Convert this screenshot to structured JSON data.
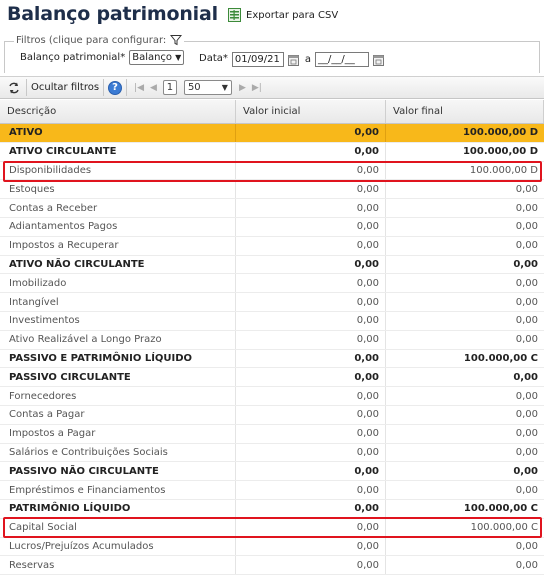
{
  "header": {
    "title": "Balanço patrimonial",
    "export_label": "Exportar para CSV"
  },
  "filters": {
    "legend": "Filtros (clique para configurar:",
    "report_label": "Balanço patrimonial*",
    "report_value": "Balanço",
    "date_label": "Data*",
    "date_from": "01/09/21",
    "date_sep": "a",
    "date_to": "__/__/__"
  },
  "toolbar": {
    "hide_filters_label": "Ocultar filtros",
    "help_glyph": "?",
    "page": "1",
    "page_size": "50"
  },
  "grid": {
    "columns": [
      "Descrição",
      "Valor inicial",
      "Valor final"
    ],
    "rows": [
      {
        "desc": "ATIVO",
        "ini": "0,00",
        "fin": "100.000,00 D",
        "style": "hl"
      },
      {
        "desc": "ATIVO CIRCULANTE",
        "ini": "0,00",
        "fin": "100.000,00 D",
        "style": "group"
      },
      {
        "desc": "Disponibilidades",
        "ini": "0,00",
        "fin": "100.000,00 D",
        "style": "normal"
      },
      {
        "desc": "Estoques",
        "ini": "0,00",
        "fin": "0,00",
        "style": "normal"
      },
      {
        "desc": "Contas a Receber",
        "ini": "0,00",
        "fin": "0,00",
        "style": "normal"
      },
      {
        "desc": "Adiantamentos Pagos",
        "ini": "0,00",
        "fin": "0,00",
        "style": "normal"
      },
      {
        "desc": "Impostos a Recuperar",
        "ini": "0,00",
        "fin": "0,00",
        "style": "normal"
      },
      {
        "desc": "ATIVO NÃO CIRCULANTE",
        "ini": "0,00",
        "fin": "0,00",
        "style": "group"
      },
      {
        "desc": "Imobilizado",
        "ini": "0,00",
        "fin": "0,00",
        "style": "normal"
      },
      {
        "desc": "Intangível",
        "ini": "0,00",
        "fin": "0,00",
        "style": "normal"
      },
      {
        "desc": "Investimentos",
        "ini": "0,00",
        "fin": "0,00",
        "style": "normal"
      },
      {
        "desc": "Ativo Realizável a Longo Prazo",
        "ini": "0,00",
        "fin": "0,00",
        "style": "normal"
      },
      {
        "desc": "PASSIVO E PATRIMÔNIO LÍQUIDO",
        "ini": "0,00",
        "fin": "100.000,00 C",
        "style": "group"
      },
      {
        "desc": "PASSIVO CIRCULANTE",
        "ini": "0,00",
        "fin": "0,00",
        "style": "group"
      },
      {
        "desc": "Fornecedores",
        "ini": "0,00",
        "fin": "0,00",
        "style": "normal"
      },
      {
        "desc": "Contas a Pagar",
        "ini": "0,00",
        "fin": "0,00",
        "style": "normal"
      },
      {
        "desc": "Impostos a Pagar",
        "ini": "0,00",
        "fin": "0,00",
        "style": "normal"
      },
      {
        "desc": "Salários e Contribuições Sociais",
        "ini": "0,00",
        "fin": "0,00",
        "style": "normal"
      },
      {
        "desc": "PASSIVO NÃO CIRCULANTE",
        "ini": "0,00",
        "fin": "0,00",
        "style": "group"
      },
      {
        "desc": "Empréstimos e Financiamentos",
        "ini": "0,00",
        "fin": "0,00",
        "style": "normal"
      },
      {
        "desc": "PATRIMÔNIO LÍQUIDO",
        "ini": "0,00",
        "fin": "100.000,00 C",
        "style": "group"
      },
      {
        "desc": "Capital Social",
        "ini": "0,00",
        "fin": "100.000,00 C",
        "style": "normal"
      },
      {
        "desc": "Lucros/Prejuízos Acumulados",
        "ini": "0,00",
        "fin": "0,00",
        "style": "normal"
      },
      {
        "desc": "Reservas",
        "ini": "0,00",
        "fin": "0,00",
        "style": "normal"
      }
    ]
  },
  "highlight_color": "#e0141e",
  "accent_row_color": "#f8b81a",
  "title_color": "#1e2e4a"
}
